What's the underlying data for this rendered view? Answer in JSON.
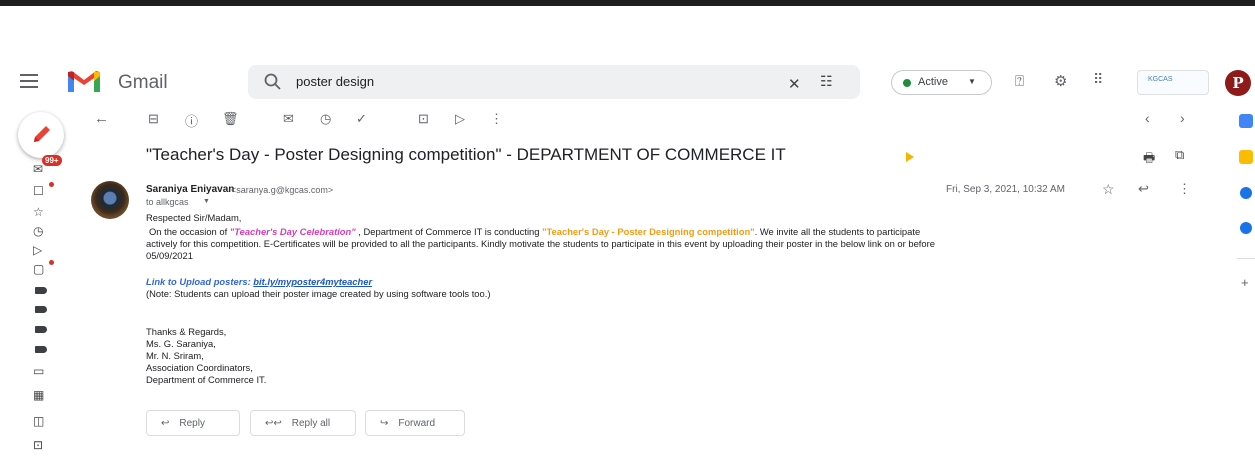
{
  "app": {
    "name": "Gmail"
  },
  "search": {
    "query": "poster design"
  },
  "header": {
    "status_label": "Active",
    "org_logo_text": "KGCAS"
  },
  "account": {
    "initial": "P"
  },
  "inbox": {
    "unread_badge": "99+"
  },
  "email": {
    "subject": "\"Teacher's Day - Poster Designing competition\" - DEPARTMENT OF COMMERCE IT",
    "sender_name": "Saraniya Eniyavan",
    "sender_email": "<saranya.g@kgcas.com>",
    "to": "to allkgcas",
    "date": "Fri, Sep 3, 2021, 10:32 AM",
    "greeting": "Respected Sir/Madam,",
    "p1_a": "On the occasion of ",
    "p1_b": "\"Teacher's Day Celebration\"",
    "p1_c": " , Department of Commerce IT is conducting ",
    "p1_d": "\"Teacher's Day - Poster Designing competition\"",
    "p1_e": ".  We invite all the students to participate",
    "p2": "actively for this competition. E-Certificates will be provided to all the participants. Kindly motivate the students to participate in this event by uploading their poster in the below link on or before",
    "p3": "05/09/2021",
    "link_label": "Link to Upload posters: ",
    "link_url": "bit.ly/myposter4myteacher",
    "note": "(Note: Students can upload their poster image created by using software tools too.)",
    "sig1": "Thanks & Regards,",
    "sig2": "Ms. G. Saraniya,",
    "sig3": "Mr. N. Sriram,",
    "sig4": "Association Coordinators,",
    "sig5": "Department of Commerce IT."
  },
  "actions": {
    "reply": "Reply",
    "reply_all": "Reply all",
    "forward": "Forward"
  },
  "colors": {
    "accent_red": "#d93025",
    "tag_yellow": "#f4b400",
    "active_green": "#1e8e3e",
    "link_blue": "#1a56c4"
  }
}
